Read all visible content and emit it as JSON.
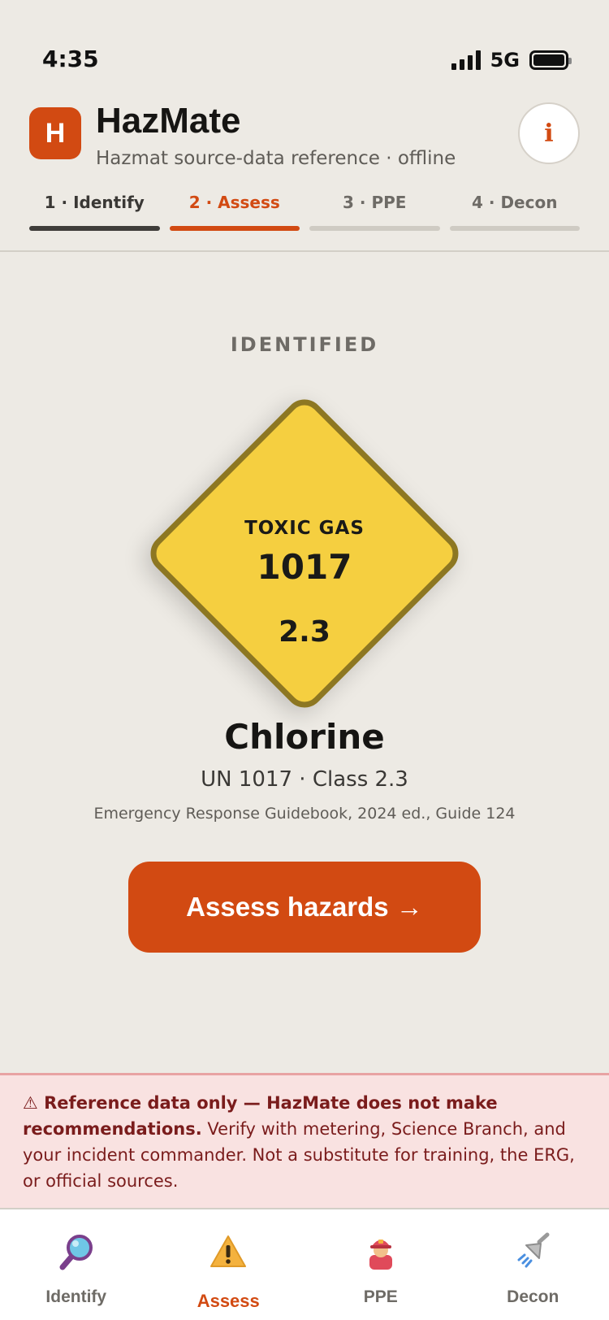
{
  "status_bar": {
    "time": "4:35",
    "network": "5G"
  },
  "app": {
    "logo_letter": "H",
    "title": "HazMate",
    "subtitle": "Hazmat source-data reference · offline",
    "info_icon": "i"
  },
  "steps": [
    {
      "label": "1 · Identify",
      "state": "done"
    },
    {
      "label": "2 · Assess",
      "state": "active"
    },
    {
      "label": "3 · PPE",
      "state": "pending"
    },
    {
      "label": "4 · Decon",
      "state": "pending"
    }
  ],
  "main": {
    "section_label": "IDENTIFIED",
    "placard": {
      "hazard": "TOXIC GAS",
      "un_number": "1017",
      "class": "2.3",
      "color": "#f5cf40",
      "border_color": "#8d7722"
    },
    "chemical_name": "Chlorine",
    "chemical_id": "UN 1017 · Class 2.3",
    "source": "Emergency Response Guidebook, 2024 ed., Guide 124",
    "cta_label": "Assess hazards →"
  },
  "disclaimer": {
    "icon": "⚠",
    "bold_text": "Reference data only — HazMate does not make recommendations.",
    "text": " Verify with metering, Science Branch, and your incident commander. Not a substitute for training, the ERG, or official sources."
  },
  "bottom_nav": [
    {
      "label": "Identify",
      "icon": "magnifier-icon",
      "active": false
    },
    {
      "label": "Assess",
      "icon": "warning-icon",
      "active": true
    },
    {
      "label": "PPE",
      "icon": "firefighter-icon",
      "active": false
    },
    {
      "label": "Decon",
      "icon": "shower-icon",
      "active": false
    }
  ],
  "colors": {
    "accent": "#d24a12",
    "background": "#edeae4",
    "disclaimer_bg": "#f9e2e1"
  }
}
